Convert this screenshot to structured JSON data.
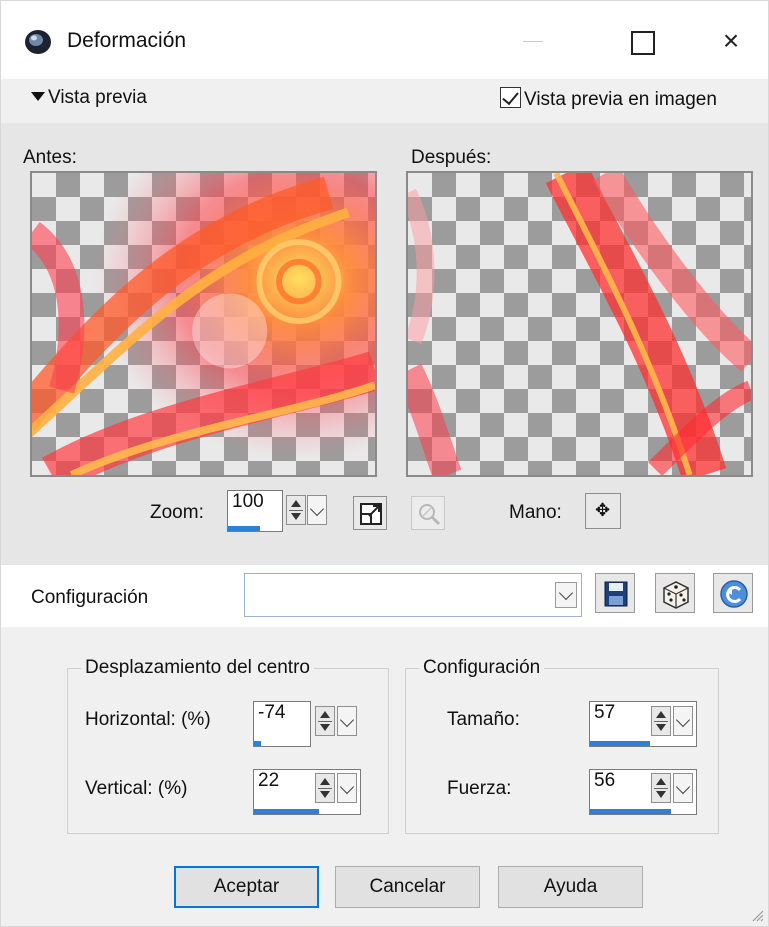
{
  "window": {
    "title": "Deformación",
    "controls": [
      "minimize",
      "maximize",
      "close"
    ],
    "close_glyph": "×"
  },
  "preview": {
    "toggle_label": "Vista previa",
    "in_image_label": "Vista previa en imagen",
    "in_image_checked": true,
    "before_label": "Antes:",
    "after_label": "Después:"
  },
  "zoom": {
    "label": "Zoom:",
    "value": "100",
    "progress": 0.6,
    "fit_icon": "fit-window-icon",
    "zoom_tool_icon": "magnifier-icon",
    "hand_label": "Mano:",
    "hand_icon": "move-arrows-icon",
    "hand_glyph": "✥"
  },
  "config": {
    "label": "Configuración",
    "value": "",
    "buttons": [
      "save-icon",
      "dice-icon",
      "reset-icon"
    ]
  },
  "center_offset": {
    "title": "Desplazamiento del centro",
    "horizontal": {
      "label": "Horizontal: (%)",
      "value": "-74",
      "progress": 0.13
    },
    "vertical": {
      "label": "Vertical: (%)",
      "value": "22",
      "progress": 0.61
    }
  },
  "settings": {
    "title": "Configuración",
    "size": {
      "label": "Tamaño:",
      "value": "57",
      "progress": 0.57
    },
    "strength": {
      "label": "Fuerza:",
      "value": "56",
      "progress": 0.76
    }
  },
  "buttons": {
    "ok": "Aceptar",
    "cancel": "Cancelar",
    "help": "Ayuda"
  },
  "colors": {
    "accent": "#0078d7",
    "progress": "#2f7fd8",
    "preview_bg": "#e6e6e6"
  }
}
